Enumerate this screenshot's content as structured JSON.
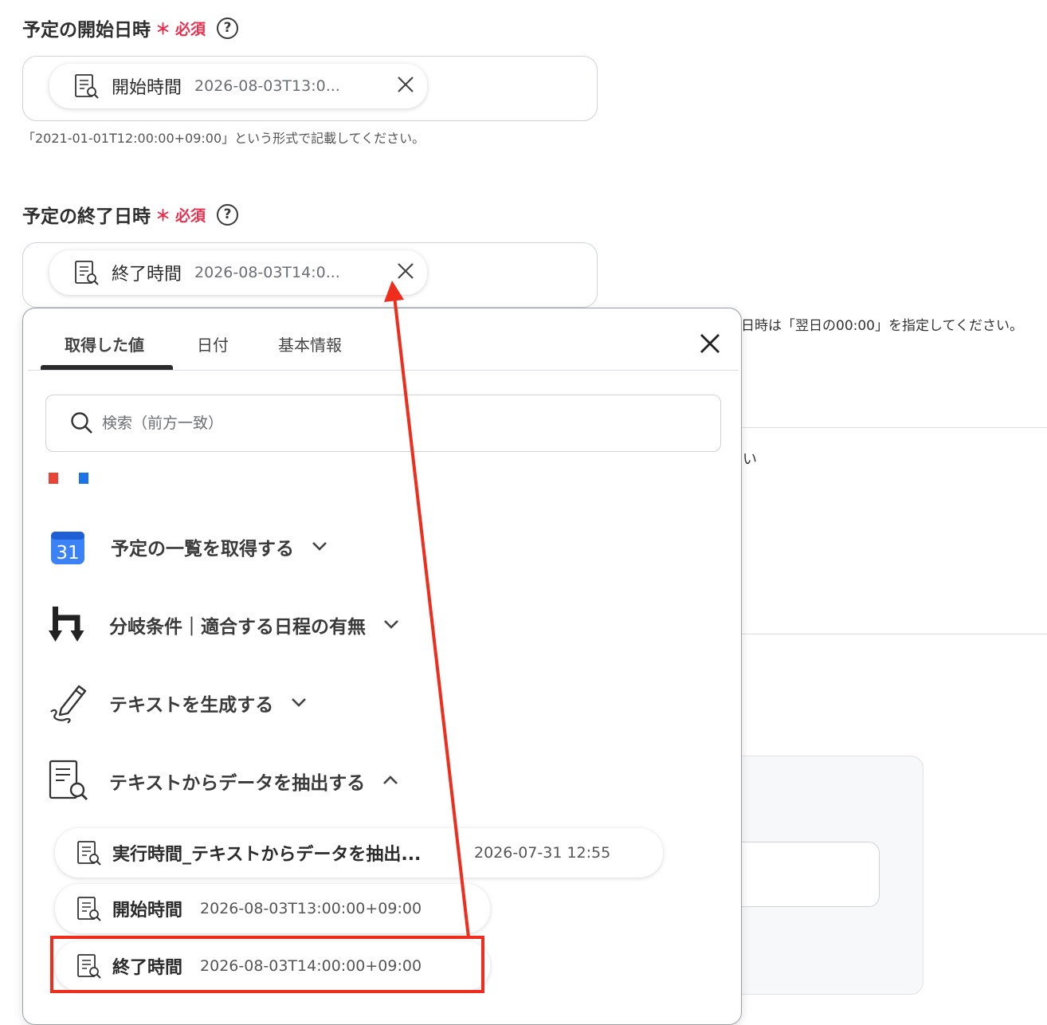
{
  "start_field": {
    "label": "予定の開始日時",
    "required": "必須",
    "help": "?",
    "chip_name": "開始時間",
    "chip_value": "2026-08-03T13:0...",
    "hint": "「2021-01-01T12:00:00+09:00」という形式で記載してください。"
  },
  "end_field": {
    "label": "予定の終了日時",
    "required": "必須",
    "help": "?",
    "chip_name": "終了時間",
    "chip_value": "2026-08-03T14:0...",
    "hint_partial": "日時は「翌日の00:00」を指定してください。"
  },
  "background": {
    "partial_text": "い"
  },
  "picker": {
    "tabs": [
      {
        "label": "取得した値"
      },
      {
        "label": "日付"
      },
      {
        "label": "基本情報"
      }
    ],
    "search_placeholder": "検索（前方一致）",
    "groups": [
      {
        "title": "予定の一覧を取得する",
        "icon": "calendar-icon",
        "icon_text": "31"
      },
      {
        "title": "分岐条件｜適合する日程の有無",
        "icon": "branch-icon"
      },
      {
        "title": "テキストを生成する",
        "icon": "pencil-icon"
      },
      {
        "title": "テキストからデータを抽出する",
        "icon": "document-search-icon"
      }
    ],
    "items": [
      {
        "name": "実行時間_テキストからデータを抽出...",
        "value": "2026-07-31 12:55"
      },
      {
        "name": "開始時間",
        "value": "2026-08-03T13:00:00+09:00"
      },
      {
        "name": "終了時間",
        "value": "2026-08-03T14:00:00+09:00"
      }
    ]
  },
  "colors": {
    "required": "#e8304f",
    "annotation": "#ee2d1d",
    "tab_indicator": "#2b2b2b"
  }
}
